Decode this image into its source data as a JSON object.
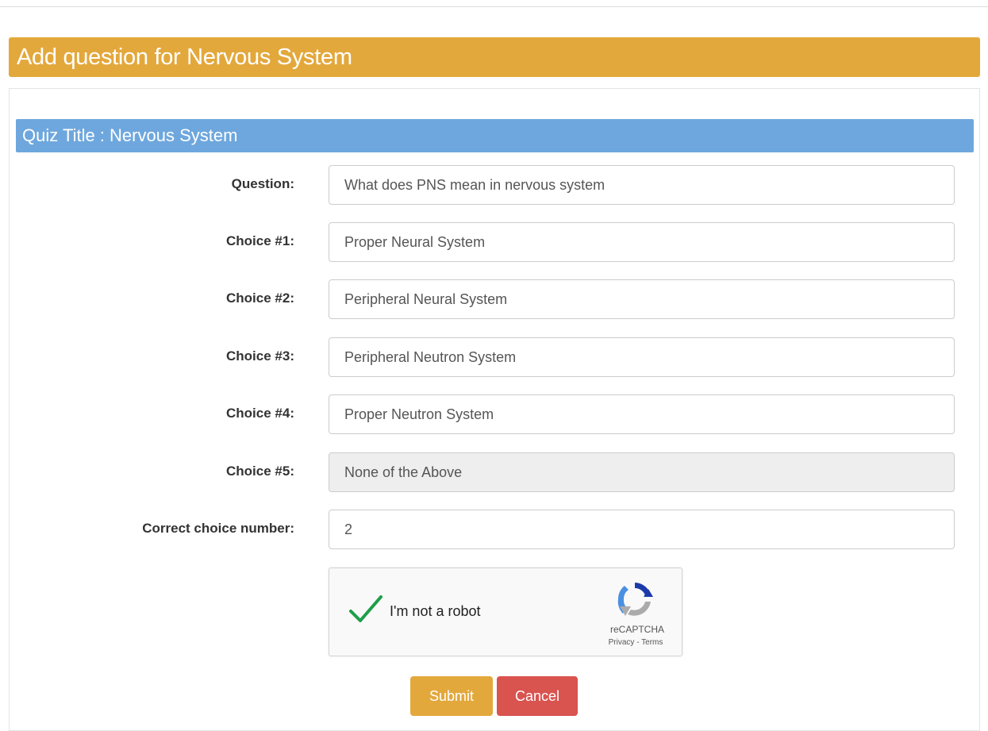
{
  "header": {
    "title": "Add question for Nervous System"
  },
  "quiz": {
    "title": "Quiz Title : Nervous System"
  },
  "form": {
    "question": {
      "label": "Question:",
      "value": "What does PNS mean in nervous system"
    },
    "choice1": {
      "label": "Choice #1:",
      "value": "Proper Neural System"
    },
    "choice2": {
      "label": "Choice #2:",
      "value": "Peripheral Neural System"
    },
    "choice3": {
      "label": "Choice #3:",
      "value": "Peripheral Neutron System"
    },
    "choice4": {
      "label": "Choice #4:",
      "value": "Proper Neutron System"
    },
    "choice5": {
      "label": "Choice #5:",
      "value": "None of the Above",
      "readonly": true
    },
    "correct": {
      "label": "Correct choice number:",
      "value": "2"
    }
  },
  "recaptcha": {
    "label": "I'm not a robot",
    "brand": "reCAPTCHA",
    "privacy": "Privacy",
    "separator": " - ",
    "terms": "Terms",
    "checked": true,
    "check_color": "#1e9e4a"
  },
  "buttons": {
    "submit": "Submit",
    "cancel": "Cancel"
  },
  "colors": {
    "header_bg": "#e3a83c",
    "quiz_bar_bg": "#6ea7dd",
    "submit_bg": "#e3a83c",
    "cancel_bg": "#d9534f"
  }
}
